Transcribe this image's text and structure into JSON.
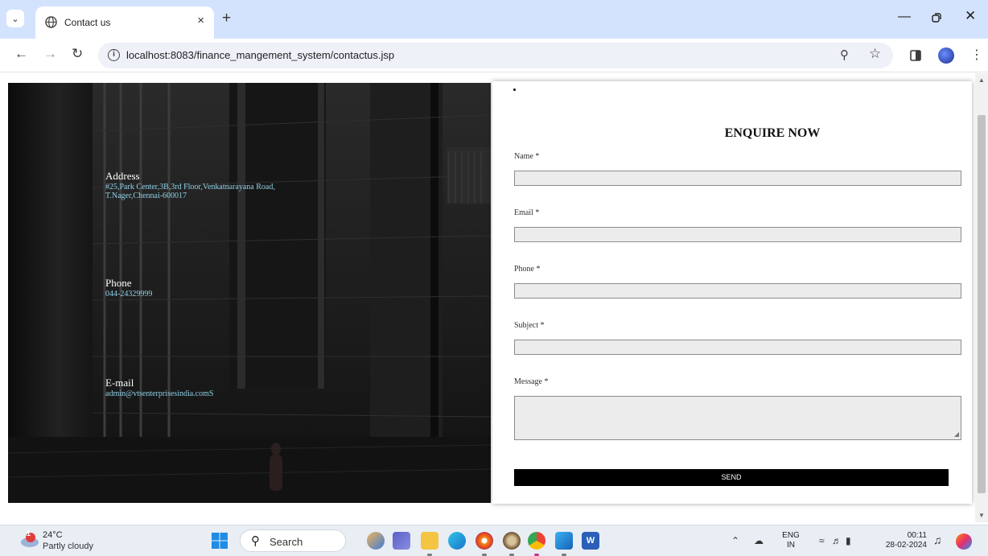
{
  "browser": {
    "tab_title": "Contact us",
    "tab_close": "×",
    "new_tab": "+",
    "url": "localhost:8083/finance_mangement_system/contactus.jsp",
    "icons": [
      "chevron-down-icon",
      "globe-icon",
      "close-icon",
      "plus-icon",
      "minimize-icon",
      "restore-icon",
      "back-icon",
      "forward-icon",
      "reload-icon",
      "info-icon",
      "zoom-icon",
      "star-icon",
      "side-panel-icon",
      "avatar",
      "more-icon"
    ]
  },
  "contact": {
    "address_label": "Address",
    "address_line1": "#25,Park Center,3B,3rd Floor,Venkatnarayana Road,",
    "address_line2": "T.Nager,Chennai-600017",
    "phone_label": "Phone",
    "phone_value": "044-24329999",
    "email_label": "E-mail",
    "email_value": "admin@vtsenterprisesindia.comS"
  },
  "form": {
    "title": "ENQUIRE NOW",
    "fields": [
      {
        "label": "Name *",
        "value": ""
      },
      {
        "label": "Email *",
        "value": ""
      },
      {
        "label": "Phone *",
        "value": ""
      },
      {
        "label": "Subject *",
        "value": ""
      },
      {
        "label": "Message *",
        "value": ""
      }
    ],
    "submit_label": "SEND"
  },
  "taskbar": {
    "weather_temp": "24°C",
    "weather_desc": "Partly cloudy",
    "weather_badge": "1",
    "search_label": "Search",
    "lang_top": "ENG",
    "lang_bottom": "IN",
    "time": "00:11",
    "date": "28-02-2024"
  },
  "colors": {
    "tabstrip": "#d3e3fd",
    "contact_value": "#8fd0e6",
    "send_button": "#000000"
  }
}
